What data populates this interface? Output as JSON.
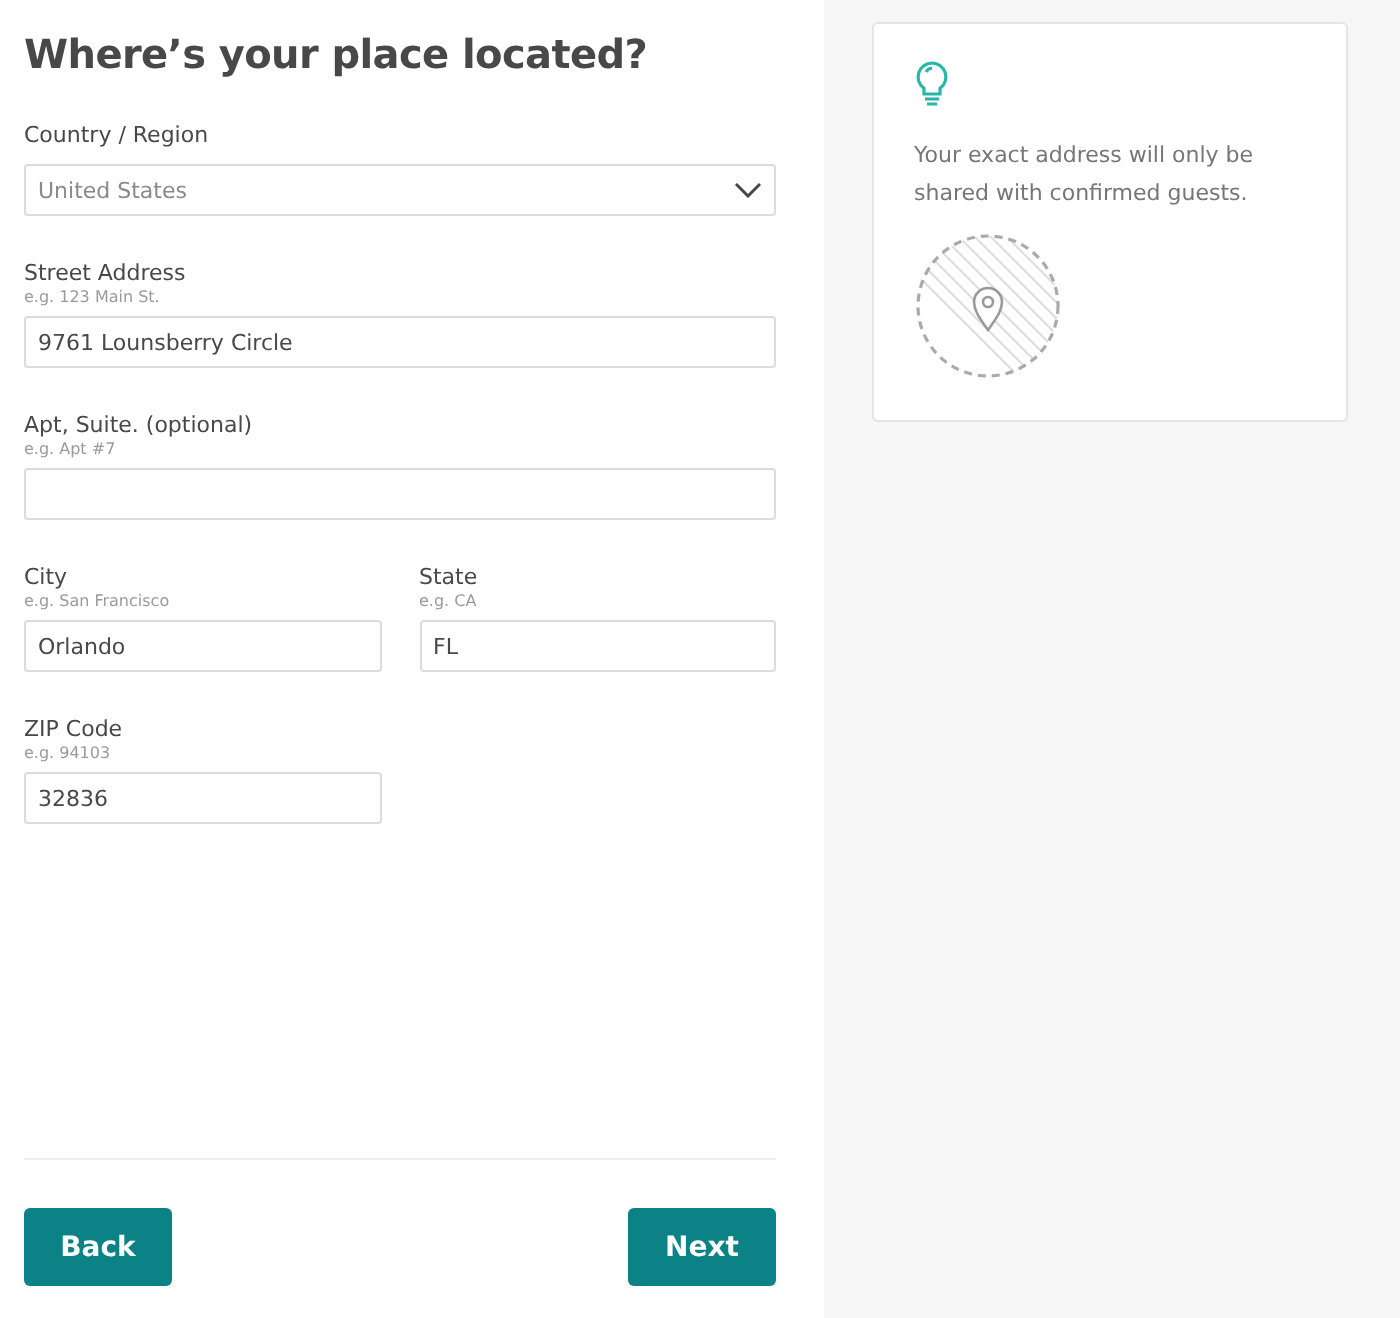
{
  "title": "Where’s your place located?",
  "rows": [
    [
      {
        "kind": "select",
        "label": "Country / Region",
        "value": "United States"
      }
    ],
    [
      {
        "kind": "text",
        "label": "Street Address",
        "hint": "e.g. 123 Main St.",
        "value": "9761 Lounsberry Circle"
      }
    ],
    [
      {
        "kind": "text",
        "label": "Apt, Suite. (optional)",
        "hint": "e.g. Apt #7"
      }
    ],
    [
      {
        "kind": "text",
        "label": "City",
        "hint": "e.g. San Francisco",
        "value": "Orlando"
      },
      {
        "kind": "text",
        "label": "State",
        "hint": "e.g. CA",
        "value": "FL"
      }
    ],
    [
      {
        "kind": "text",
        "label": "ZIP Code",
        "hint": "e.g. 94103",
        "value": "32836"
      },
      {
        "kind": "empty"
      }
    ]
  ],
  "buttons": {
    "back": "Back",
    "next": "Next"
  },
  "tip": {
    "text": "Your exact address will only be shared with confirmed guests."
  }
}
